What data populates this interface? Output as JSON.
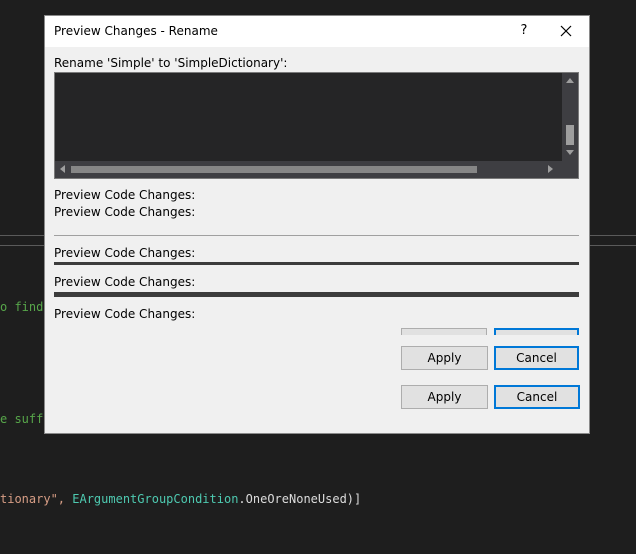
{
  "editor": {
    "line_find": "o find",
    "line_suffix": "e suff",
    "line_code_string": "tionary\", ",
    "line_code_type": "EArgumentGroupCondition",
    "line_code_rest": ".OneOreNoneUsed)]"
  },
  "dialog": {
    "title": "Preview Changes - Rename",
    "help_label": "?",
    "rename_label": "Rename 'Simple' to 'SimpleDictionary':",
    "preview_code_label": "Preview Code Changes:",
    "apply_label": "Apply",
    "cancel_label": "Cancel"
  },
  "colors": {
    "dialog_bg": "#f0f0f0",
    "preview_bg": "#252526",
    "accent": "#0078d7",
    "editor_bg": "#1e1e1e",
    "editor_type": "#4ec9b0",
    "editor_string": "#d69d85",
    "editor_comment": "#57a64a"
  },
  "icons": {
    "close": "close-icon",
    "scroll_up": "arrow-up-icon",
    "scroll_down": "arrow-down-icon",
    "scroll_left": "arrow-left-icon",
    "scroll_right": "arrow-right-icon"
  }
}
